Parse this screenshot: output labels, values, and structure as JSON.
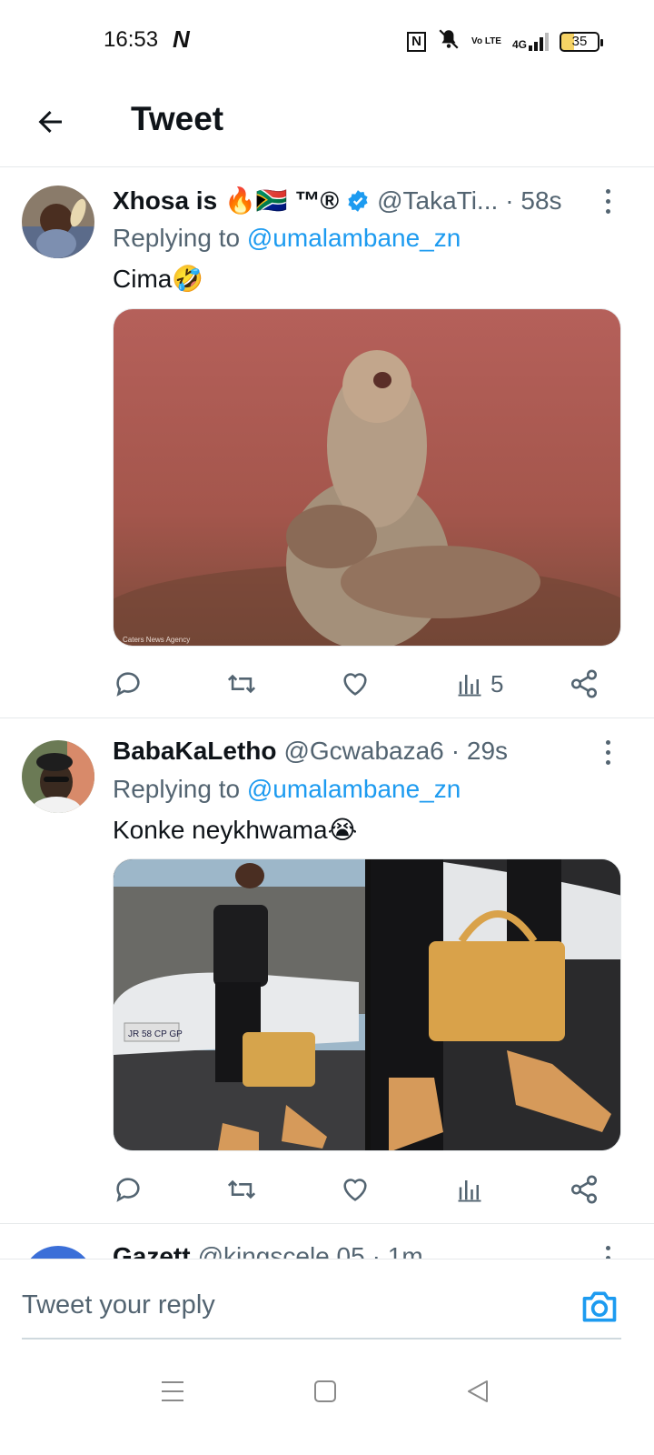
{
  "status_bar": {
    "time": "16:53",
    "n_icon": "N",
    "nfc_label": "N",
    "volte_label": "Vo LTE",
    "signal_label": "4G",
    "battery_level": "35"
  },
  "header": {
    "title": "Tweet"
  },
  "tweets": [
    {
      "name": "Xhosa is 🔥🇿🇦 ™®",
      "handle": "@TakaTi...",
      "time": "· 58s",
      "replying_prefix": "Replying to ",
      "replying_to": "@umalambane_zn",
      "text": "Cima🤣",
      "views": "5"
    },
    {
      "name": "BabaKaLetho",
      "handle": "@Gcwabaza6",
      "time": "· 29s",
      "replying_prefix": "Replying to ",
      "replying_to": "@umalambane_zn",
      "text": "Konke neykhwama😭",
      "views": ""
    },
    {
      "name": "Gazett",
      "handle": "@kingscele 05",
      "time": "· 1m"
    }
  ],
  "media": {
    "watermark": "Caters News Agency",
    "plate": "JR 58 CP GP"
  },
  "reply_bar": {
    "placeholder": "Tweet your reply"
  },
  "colors": {
    "accent": "#1d9bf0",
    "text": "#0f1419",
    "muted": "#536471"
  }
}
